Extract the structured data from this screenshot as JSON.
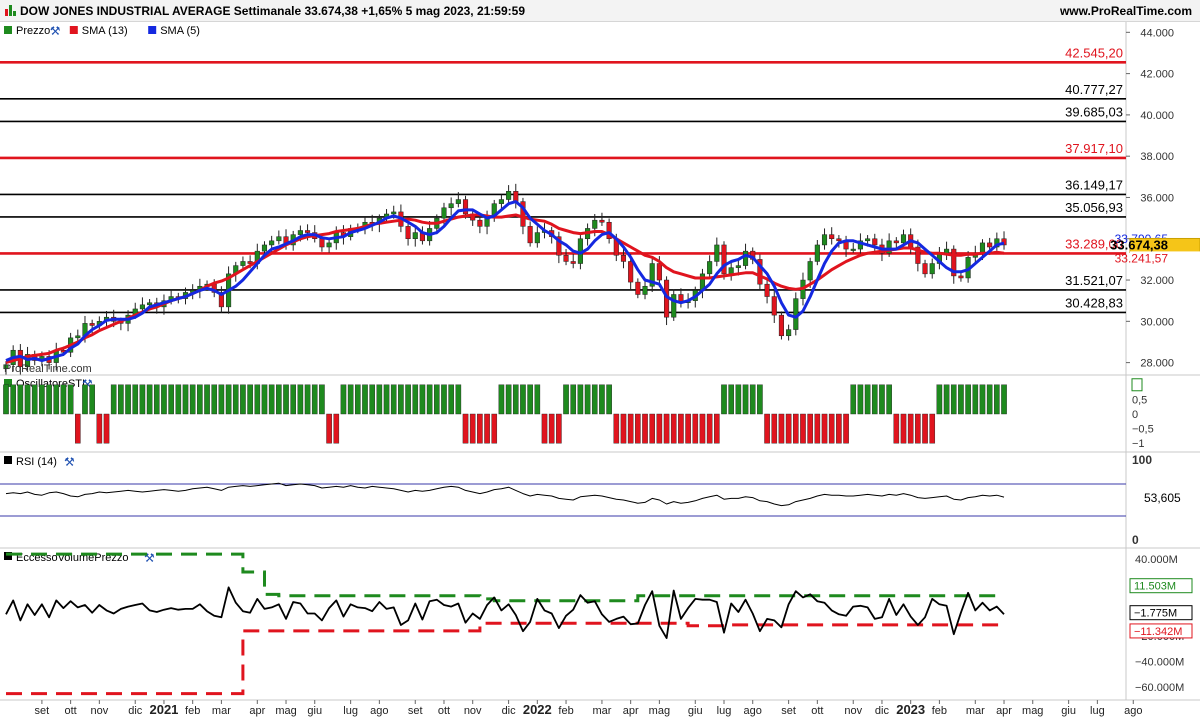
{
  "header": {
    "title": "DOW JONES INDUSTRIAL AVERAGE Settimanale 33.674,38 +1,65% 5 mag 2023, 21:59:59",
    "site": "www.ProRealTime.com",
    "watermark": "ProRealTime.com"
  },
  "legend": [
    {
      "label": "Prezzo",
      "color": "#1e8a1e",
      "icon": "candle-icon"
    },
    {
      "label": "SMA (13)",
      "color": "#e0141e",
      "icon": "line-icon"
    },
    {
      "label": "SMA (5)",
      "color": "#1428e0",
      "icon": "line-icon"
    }
  ],
  "panels": {
    "sti": "OscillatoreSTI",
    "rsi": "RSI (14)",
    "volume": "EccessoVolumePrezzo"
  },
  "chart_data": [
    {
      "type": "candlestick",
      "ylim": [
        27400,
        44500
      ],
      "price_ticks": [
        "44.000",
        "42.000",
        "40.000",
        "38.000",
        "36.000",
        "34.000",
        "32.000",
        "30.000",
        "28.000"
      ],
      "price_tick_values": [
        44000,
        42000,
        40000,
        38000,
        36000,
        34000,
        32000,
        30000,
        28000
      ],
      "levels": [
        {
          "label": "42.545,20",
          "value": 42545.2,
          "color": "#e0141e"
        },
        {
          "label": "40.777,27",
          "value": 40777.27,
          "color": "#000000"
        },
        {
          "label": "39.685,03",
          "value": 39685.03,
          "color": "#000000"
        },
        {
          "label": "37.917,10",
          "value": 37917.1,
          "color": "#e0141e"
        },
        {
          "label": "36.149,17",
          "value": 36149.17,
          "color": "#000000"
        },
        {
          "label": "35.056,93",
          "value": 35056.93,
          "color": "#000000"
        },
        {
          "label": "33.289,00",
          "value": 33289.0,
          "color": "#e0141e"
        },
        {
          "label": "31.521,07",
          "value": 31521.07,
          "color": "#000000"
        },
        {
          "label": "30.428,83",
          "value": 30428.83,
          "color": "#000000"
        }
      ],
      "markers": [
        {
          "label": "33.790,65",
          "value": 33790.65,
          "color": "#1428e0",
          "bg": "#ffffff"
        },
        {
          "label": "33.674,38",
          "value": 33674.38,
          "color": "#000000",
          "bg": "#f5c518"
        },
        {
          "label": "33.241,57",
          "value": 33241.57,
          "color": "#e0141e",
          "bg": "#ffffff"
        }
      ],
      "closes": [
        27900,
        28600,
        27800,
        28400,
        28100,
        28300,
        28000,
        28600,
        28500,
        29200,
        29300,
        29900,
        29800,
        30000,
        30200,
        30000,
        29900,
        30300,
        30600,
        30800,
        30900,
        30700,
        31000,
        31200,
        31100,
        31400,
        31500,
        31700,
        31800,
        31400,
        30700,
        32300,
        32700,
        32900,
        32800,
        33400,
        33700,
        33900,
        34100,
        33700,
        34200,
        34400,
        34300,
        34000,
        33600,
        33800,
        34300,
        34100,
        34500,
        34500,
        34800,
        34700,
        35000,
        35200,
        35300,
        34600,
        34000,
        34300,
        33900,
        34500,
        35000,
        35500,
        35700,
        35900,
        35200,
        34900,
        34600,
        35000,
        35700,
        35900,
        36300,
        35800,
        34600,
        33800,
        34300,
        34400,
        34100,
        33200,
        32900,
        32800,
        34000,
        34500,
        34900,
        34800,
        34000,
        33200,
        32900,
        31900,
        31300,
        31700,
        32800,
        32000,
        30200,
        31300,
        30900,
        31000,
        31500,
        32300,
        32900,
        33700,
        32300,
        32600,
        32700,
        33400,
        33000,
        31800,
        31200,
        30300,
        29300,
        29600,
        31100,
        32000,
        32900,
        33700,
        34200,
        34000,
        33900,
        33500,
        33500,
        33900,
        34000,
        33700,
        33300,
        33900,
        33800,
        34200,
        33600,
        32800,
        32300,
        32800,
        33300,
        33500,
        32200,
        32100,
        33100,
        33300,
        33800,
        33600,
        34000,
        33700
      ],
      "sma13": [
        28000,
        28100,
        28200,
        28300,
        28350,
        28400,
        28450,
        28600,
        28700,
        28850,
        29000,
        29200,
        29350,
        29550,
        29700,
        29850,
        30000,
        30150,
        30300,
        30450,
        30600,
        30700,
        30850,
        31000,
        31100,
        31200,
        31350,
        31500,
        31700,
        31850,
        31950,
        32100,
        32300,
        32500,
        32700,
        32900,
        33100,
        33300,
        33500,
        33700,
        33850,
        34000,
        34100,
        34150,
        34200,
        34250,
        34350,
        34400,
        34450,
        34500,
        34600,
        34700,
        34750,
        34800,
        34850,
        34900,
        34950,
        34900,
        34800,
        34750,
        34750,
        34850,
        34950,
        35050,
        35100,
        35150,
        35150,
        35100,
        35050,
        35050,
        35100,
        35150,
        35050,
        34950,
        34900,
        34850,
        34700,
        34500,
        34400,
        34300,
        34250,
        34300,
        34350,
        34350,
        34200,
        34000,
        33800,
        33600,
        33400,
        33200,
        33100,
        32900,
        32600,
        32400,
        32300,
        32200,
        32100,
        32100,
        32100,
        32150,
        32200,
        32250,
        32300,
        32350,
        32350,
        32200,
        32050,
        31850,
        31700,
        31600,
        31550,
        31600,
        31800,
        32000,
        32250,
        32500,
        32700,
        32900,
        33050,
        33200,
        33300,
        33350,
        33400,
        33450,
        33500,
        33550,
        33550,
        33450,
        33350,
        33300,
        33300,
        33250,
        33200,
        33200,
        33250,
        33250,
        33300,
        33300,
        33350,
        33300
      ],
      "sma5": [
        28100,
        28250,
        28300,
        28150,
        28200,
        28100,
        28200,
        28300,
        28400,
        28700,
        28900,
        29300,
        29600,
        29800,
        30050,
        30100,
        30100,
        30100,
        30200,
        30400,
        30700,
        30800,
        30900,
        31000,
        31100,
        31200,
        31350,
        31500,
        31600,
        31500,
        31300,
        31500,
        31700,
        32000,
        32400,
        32800,
        33200,
        33500,
        33600,
        33750,
        33900,
        34100,
        34200,
        34200,
        34050,
        34000,
        34050,
        34100,
        34300,
        34400,
        34500,
        34650,
        34800,
        35000,
        35100,
        35000,
        34800,
        34600,
        34300,
        34200,
        34300,
        34600,
        35000,
        35350,
        35400,
        35400,
        35200,
        35000,
        35100,
        35400,
        35700,
        35800,
        35500,
        35000,
        34700,
        34400,
        34200,
        33900,
        33700,
        33400,
        33300,
        33500,
        33900,
        34200,
        34300,
        34000,
        33600,
        33100,
        32500,
        32000,
        31900,
        31800,
        31200,
        31000,
        30900,
        31000,
        31200,
        31500,
        31800,
        32300,
        32700,
        32900,
        33000,
        33200,
        33100,
        32700,
        32300,
        31700,
        30900,
        30300,
        30200,
        30500,
        31200,
        32000,
        32800,
        33400,
        33800,
        33900,
        33900,
        33800,
        33700,
        33600,
        33500,
        33500,
        33500,
        33700,
        33900,
        33800,
        33500,
        33200,
        32900,
        32600,
        32400,
        32400,
        32500,
        32800,
        33100,
        33400,
        33700,
        33790
      ]
    },
    {
      "type": "bar",
      "name": "OscillatoreSTI",
      "ylim": [
        -1.3,
        1.3
      ],
      "ticks": [
        "1",
        "0,5",
        "0",
        "−0,5",
        "−1"
      ],
      "tick_values": [
        1,
        0.5,
        0,
        -0.5,
        -1
      ],
      "values": [
        1,
        1,
        1,
        1,
        1,
        1,
        1,
        1,
        1,
        1,
        -1,
        1,
        1,
        -1,
        -1,
        1,
        1,
        1,
        1,
        1,
        1,
        1,
        1,
        1,
        1,
        1,
        1,
        1,
        1,
        1,
        1,
        1,
        1,
        1,
        1,
        1,
        1,
        1,
        1,
        1,
        1,
        1,
        1,
        1,
        1,
        -1,
        -1,
        1,
        1,
        1,
        1,
        1,
        1,
        1,
        1,
        1,
        1,
        1,
        1,
        1,
        1,
        1,
        1,
        1,
        -1,
        -1,
        -1,
        -1,
        -1,
        1,
        1,
        1,
        1,
        1,
        1,
        -1,
        -1,
        -1,
        1,
        1,
        1,
        1,
        1,
        1,
        1,
        -1,
        -1,
        -1,
        -1,
        -1,
        -1,
        -1,
        -1,
        -1,
        -1,
        -1,
        -1,
        -1,
        -1,
        -1,
        1,
        1,
        1,
        1,
        1,
        1,
        -1,
        -1,
        -1,
        -1,
        -1,
        -1,
        -1,
        -1,
        -1,
        -1,
        -1,
        -1,
        1,
        1,
        1,
        1,
        1,
        1,
        -1,
        -1,
        -1,
        -1,
        -1,
        -1,
        1,
        1,
        1,
        1,
        1,
        1,
        1,
        1,
        1,
        1,
        1,
        -1,
        1,
        1,
        1,
        1,
        1,
        1,
        -1,
        -1,
        -1,
        -1,
        -1,
        -1,
        1,
        1,
        1,
        1
      ]
    },
    {
      "type": "line",
      "name": "RSI (14)",
      "ylim": [
        0,
        100
      ],
      "ticks": [
        "100",
        "0"
      ],
      "bands": [
        70,
        30
      ],
      "last_label": "53,605",
      "values": [
        58,
        59,
        58,
        60,
        57,
        56,
        59,
        60,
        58,
        55,
        54,
        57,
        58,
        60,
        59,
        60,
        61,
        62,
        61,
        60,
        61,
        62,
        63,
        62,
        61,
        62,
        64,
        65,
        66,
        64,
        62,
        66,
        67,
        68,
        67,
        68,
        69,
        70,
        71,
        68,
        69,
        70,
        69,
        68,
        65,
        66,
        67,
        66,
        68,
        66,
        65,
        67,
        66,
        65,
        64,
        62,
        60,
        62,
        61,
        62,
        64,
        66,
        67,
        66,
        62,
        60,
        58,
        60,
        63,
        64,
        66,
        62,
        58,
        55,
        57,
        56,
        55,
        52,
        51,
        50,
        54,
        55,
        56,
        55,
        53,
        51,
        50,
        48,
        46,
        47,
        52,
        50,
        45,
        48,
        46,
        47,
        49,
        52,
        54,
        56,
        51,
        52,
        52,
        54,
        53,
        49,
        48,
        45,
        43,
        44,
        48,
        50,
        52,
        55,
        57,
        56,
        56,
        55,
        55,
        56,
        57,
        56,
        55,
        57,
        56,
        58,
        56,
        53,
        52,
        53,
        54,
        55,
        51,
        50,
        53,
        54,
        56,
        55,
        56,
        53.6
      ]
    },
    {
      "type": "line",
      "name": "EccessoVolumePrezzo",
      "ylim": [
        -70000000,
        48000000
      ],
      "ticks": [
        "40.000M",
        "20.000M",
        "−20.000M",
        "−40.000M",
        "−60.000M"
      ],
      "tick_values": [
        40000000,
        20000000,
        -20000000,
        -40000000,
        -60000000
      ],
      "last_labels": [
        {
          "label": "11.503M",
          "value": 11503000,
          "color": "#1e8a1e"
        },
        {
          "label": "−1.775M",
          "value": -1775000,
          "color": "#000000"
        },
        {
          "label": "−11.342M",
          "value": -11342000,
          "color": "#e0141e"
        }
      ],
      "upper_band": [
        {
          "from": 0,
          "to": 33,
          "value": 44000000
        },
        {
          "from": 33,
          "to": 36,
          "value": 30000000
        },
        {
          "from": 36,
          "to": 38,
          "value": 12500000
        },
        {
          "from": 38,
          "to": 66,
          "value": 11500000
        },
        {
          "from": 66,
          "to": 68,
          "value": 9000000
        },
        {
          "from": 68,
          "to": 88,
          "value": 7500000
        },
        {
          "from": 88,
          "to": 90,
          "value": 11500000
        },
        {
          "from": 90,
          "to": 140,
          "value": 11500000
        }
      ],
      "lower_band": [
        {
          "from": 0,
          "to": 31,
          "value": -65000000
        },
        {
          "from": 31,
          "to": 33,
          "value": -65000000
        },
        {
          "from": 33,
          "to": 34,
          "value": -16000000
        },
        {
          "from": 34,
          "to": 66,
          "value": -16000000
        },
        {
          "from": 66,
          "to": 95,
          "value": -10000000
        },
        {
          "from": 95,
          "to": 100,
          "value": -12000000
        },
        {
          "from": 100,
          "to": 140,
          "value": -11300000
        }
      ]
    }
  ],
  "x_axis": {
    "labels": [
      {
        "text": "set",
        "i": 5
      },
      {
        "text": "ott",
        "i": 9
      },
      {
        "text": "nov",
        "i": 13
      },
      {
        "text": "dic",
        "i": 18
      },
      {
        "text": "2021",
        "i": 22,
        "bold": true
      },
      {
        "text": "feb",
        "i": 26
      },
      {
        "text": "mar",
        "i": 30
      },
      {
        "text": "apr",
        "i": 35
      },
      {
        "text": "mag",
        "i": 39
      },
      {
        "text": "giu",
        "i": 43
      },
      {
        "text": "lug",
        "i": 48
      },
      {
        "text": "ago",
        "i": 52
      },
      {
        "text": "set",
        "i": 57
      },
      {
        "text": "ott",
        "i": 61
      },
      {
        "text": "nov",
        "i": 65
      },
      {
        "text": "dic",
        "i": 70
      },
      {
        "text": "2022",
        "i": 74,
        "bold": true
      },
      {
        "text": "feb",
        "i": 78
      },
      {
        "text": "mar",
        "i": 83
      },
      {
        "text": "apr",
        "i": 87
      },
      {
        "text": "mag",
        "i": 91
      },
      {
        "text": "giu",
        "i": 96
      },
      {
        "text": "lug",
        "i": 100
      },
      {
        "text": "ago",
        "i": 104
      },
      {
        "text": "set",
        "i": 109
      },
      {
        "text": "ott",
        "i": 113
      },
      {
        "text": "nov",
        "i": 118
      },
      {
        "text": "dic",
        "i": 122
      },
      {
        "text": "2023",
        "i": 126,
        "bold": true
      },
      {
        "text": "feb",
        "i": 130
      },
      {
        "text": "mar",
        "i": 135
      },
      {
        "text": "apr",
        "i": 139
      },
      {
        "text": "mag",
        "i": 143
      },
      {
        "text": "giu",
        "i": 148
      },
      {
        "text": "lug",
        "i": 152
      },
      {
        "text": "ago",
        "i": 157
      }
    ]
  }
}
